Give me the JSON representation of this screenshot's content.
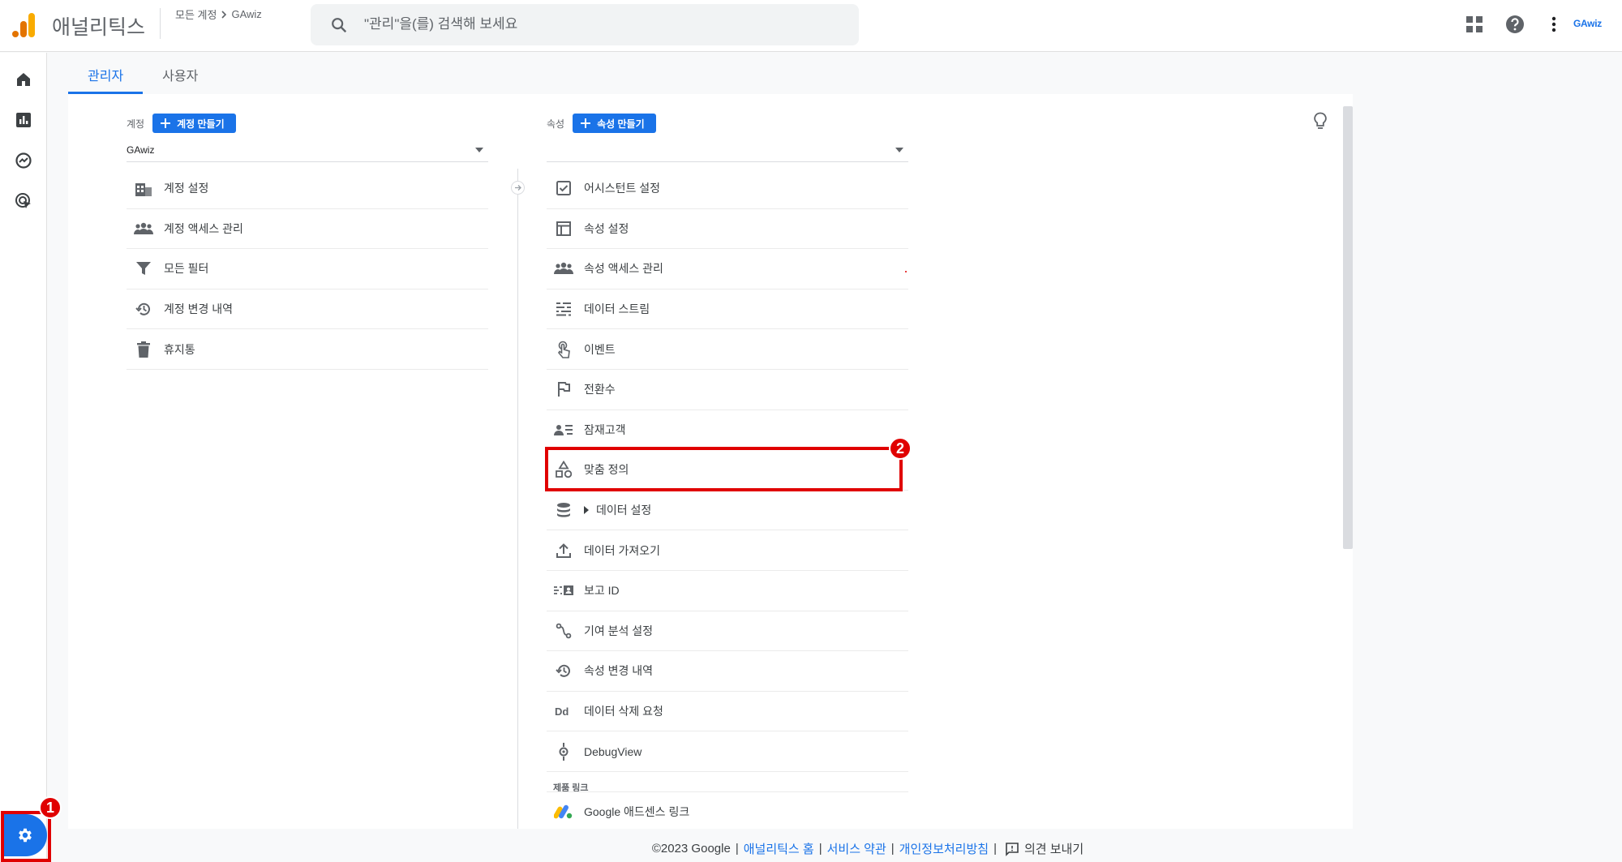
{
  "header": {
    "app_name": "애널리틱스",
    "breadcrumb": {
      "parent": "모든 계정",
      "current": "GAwiz"
    },
    "search_placeholder": "\"관리\"을(를) 검색해 보세요",
    "account_badge": "GAwiz"
  },
  "tabs": [
    {
      "label": "관리자",
      "active": true
    },
    {
      "label": "사용자",
      "active": false
    }
  ],
  "account": {
    "label": "계정",
    "create_button": "계정 만들기",
    "selected": "GAwiz",
    "items": [
      {
        "label": "계정 설정",
        "icon": "building-icon"
      },
      {
        "label": "계정 액세스 관리",
        "icon": "people-icon"
      },
      {
        "label": "모든 필터",
        "icon": "filter-icon"
      },
      {
        "label": "계정 변경 내역",
        "icon": "history-icon"
      },
      {
        "label": "휴지통",
        "icon": "trash-icon"
      }
    ]
  },
  "property": {
    "label": "속성",
    "create_button": "속성 만들기",
    "selected": "",
    "items": [
      {
        "label": "어시스턴트 설정",
        "icon": "checkbox-icon"
      },
      {
        "label": "속성 설정",
        "icon": "layout-icon"
      },
      {
        "label": "속성 액세스 관리",
        "icon": "people-icon"
      },
      {
        "label": "데이터 스트림",
        "icon": "streams-icon"
      },
      {
        "label": "이벤트",
        "icon": "touch-icon"
      },
      {
        "label": "전환수",
        "icon": "flag-icon"
      },
      {
        "label": "잠재고객",
        "icon": "audience-icon"
      },
      {
        "label": "맞춤 정의",
        "icon": "shapes-icon"
      },
      {
        "label": "데이터 설정",
        "icon": "database-icon"
      },
      {
        "label": "데이터 가져오기",
        "icon": "upload-icon"
      },
      {
        "label": "보고 ID",
        "icon": "reporting-id-icon"
      },
      {
        "label": "기여 분석 설정",
        "icon": "attribution-icon"
      },
      {
        "label": "속성 변경 내역",
        "icon": "history-icon"
      },
      {
        "label": "데이터 삭제 요청",
        "icon": "dd-icon"
      },
      {
        "label": "DebugView",
        "icon": "debug-icon"
      }
    ],
    "product_links_label": "제품 링크",
    "product_link": "Google 애드센스 링크"
  },
  "annotations": {
    "badge_1": "1",
    "badge_2": "2"
  },
  "footer": {
    "copyright": "©2023 Google",
    "links": [
      "애널리틱스 홈",
      "서비스 약관",
      "개인정보처리방침"
    ],
    "feedback": "의견 보내기"
  },
  "colors": {
    "accent": "#1a73e8",
    "highlight": "#e00000"
  }
}
